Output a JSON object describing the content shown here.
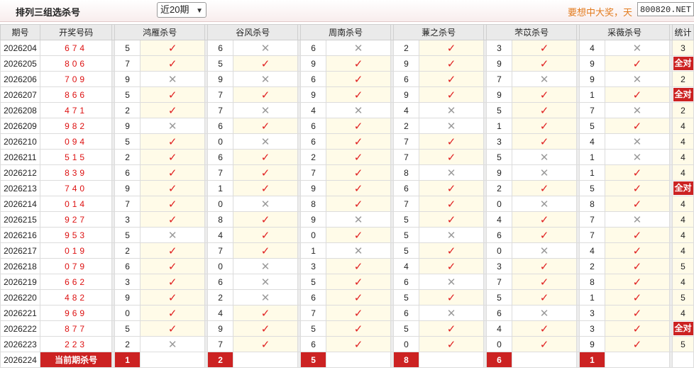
{
  "header": {
    "title": "排列三组选杀号",
    "period_select": "近20期",
    "slogan": "要想中大奖，天",
    "site": "800820.NET"
  },
  "columns": {
    "issue": "期号",
    "numbers": "开奖号码",
    "experts": [
      "鸿雁杀号",
      "谷风杀号",
      "周南杀号",
      "蒹之杀号",
      "芣苡杀号",
      "采薇杀号"
    ],
    "stats": "统计"
  },
  "icons": {
    "check": "check-icon",
    "cross": "cross-icon"
  },
  "colors": {
    "accent_red": "#cc2222",
    "check": "#e02020",
    "highlight": "#fffbe8",
    "slogan": "#e37b1e"
  },
  "rows": [
    {
      "issue": "2026204",
      "nums": "674",
      "kills": [
        {
          "n": "5",
          "ok": true
        },
        {
          "n": "6",
          "ok": false
        },
        {
          "n": "6",
          "ok": false
        },
        {
          "n": "2",
          "ok": true
        },
        {
          "n": "3",
          "ok": true
        },
        {
          "n": "4",
          "ok": false
        }
      ],
      "stat": "3"
    },
    {
      "issue": "2026205",
      "nums": "806",
      "kills": [
        {
          "n": "7",
          "ok": true
        },
        {
          "n": "5",
          "ok": true
        },
        {
          "n": "9",
          "ok": true
        },
        {
          "n": "9",
          "ok": true
        },
        {
          "n": "9",
          "ok": true
        },
        {
          "n": "9",
          "ok": true
        }
      ],
      "stat": "全对"
    },
    {
      "issue": "2026206",
      "nums": "709",
      "kills": [
        {
          "n": "9",
          "ok": false
        },
        {
          "n": "9",
          "ok": false
        },
        {
          "n": "6",
          "ok": true
        },
        {
          "n": "6",
          "ok": true
        },
        {
          "n": "7",
          "ok": false
        },
        {
          "n": "9",
          "ok": false
        }
      ],
      "stat": "2"
    },
    {
      "issue": "2026207",
      "nums": "866",
      "kills": [
        {
          "n": "5",
          "ok": true
        },
        {
          "n": "7",
          "ok": true
        },
        {
          "n": "9",
          "ok": true
        },
        {
          "n": "9",
          "ok": true
        },
        {
          "n": "9",
          "ok": true
        },
        {
          "n": "1",
          "ok": true
        }
      ],
      "stat": "全对"
    },
    {
      "issue": "2026208",
      "nums": "471",
      "kills": [
        {
          "n": "2",
          "ok": true
        },
        {
          "n": "7",
          "ok": false
        },
        {
          "n": "4",
          "ok": false
        },
        {
          "n": "4",
          "ok": false
        },
        {
          "n": "5",
          "ok": true
        },
        {
          "n": "7",
          "ok": false
        }
      ],
      "stat": "2"
    },
    {
      "issue": "2026209",
      "nums": "982",
      "kills": [
        {
          "n": "9",
          "ok": false
        },
        {
          "n": "6",
          "ok": true
        },
        {
          "n": "6",
          "ok": true
        },
        {
          "n": "2",
          "ok": false
        },
        {
          "n": "1",
          "ok": true
        },
        {
          "n": "5",
          "ok": true
        }
      ],
      "stat": "4"
    },
    {
      "issue": "2026210",
      "nums": "094",
      "kills": [
        {
          "n": "5",
          "ok": true
        },
        {
          "n": "0",
          "ok": false
        },
        {
          "n": "6",
          "ok": true
        },
        {
          "n": "7",
          "ok": true
        },
        {
          "n": "3",
          "ok": true
        },
        {
          "n": "4",
          "ok": false
        }
      ],
      "stat": "4"
    },
    {
      "issue": "2026211",
      "nums": "515",
      "kills": [
        {
          "n": "2",
          "ok": true
        },
        {
          "n": "6",
          "ok": true
        },
        {
          "n": "2",
          "ok": true
        },
        {
          "n": "7",
          "ok": true
        },
        {
          "n": "5",
          "ok": false
        },
        {
          "n": "1",
          "ok": false
        }
      ],
      "stat": "4"
    },
    {
      "issue": "2026212",
      "nums": "839",
      "kills": [
        {
          "n": "6",
          "ok": true
        },
        {
          "n": "7",
          "ok": true
        },
        {
          "n": "7",
          "ok": true
        },
        {
          "n": "8",
          "ok": false
        },
        {
          "n": "9",
          "ok": false
        },
        {
          "n": "1",
          "ok": true
        }
      ],
      "stat": "4"
    },
    {
      "issue": "2026213",
      "nums": "740",
      "kills": [
        {
          "n": "9",
          "ok": true
        },
        {
          "n": "1",
          "ok": true
        },
        {
          "n": "9",
          "ok": true
        },
        {
          "n": "6",
          "ok": true
        },
        {
          "n": "2",
          "ok": true
        },
        {
          "n": "5",
          "ok": true
        }
      ],
      "stat": "全对"
    },
    {
      "issue": "2026214",
      "nums": "014",
      "kills": [
        {
          "n": "7",
          "ok": true
        },
        {
          "n": "0",
          "ok": false
        },
        {
          "n": "8",
          "ok": true
        },
        {
          "n": "7",
          "ok": true
        },
        {
          "n": "0",
          "ok": false
        },
        {
          "n": "8",
          "ok": true
        }
      ],
      "stat": "4"
    },
    {
      "issue": "2026215",
      "nums": "927",
      "kills": [
        {
          "n": "3",
          "ok": true
        },
        {
          "n": "8",
          "ok": true
        },
        {
          "n": "9",
          "ok": false
        },
        {
          "n": "5",
          "ok": true
        },
        {
          "n": "4",
          "ok": true
        },
        {
          "n": "7",
          "ok": false
        }
      ],
      "stat": "4"
    },
    {
      "issue": "2026216",
      "nums": "953",
      "kills": [
        {
          "n": "5",
          "ok": false
        },
        {
          "n": "4",
          "ok": true
        },
        {
          "n": "0",
          "ok": true
        },
        {
          "n": "5",
          "ok": false
        },
        {
          "n": "6",
          "ok": true
        },
        {
          "n": "7",
          "ok": true
        }
      ],
      "stat": "4"
    },
    {
      "issue": "2026217",
      "nums": "019",
      "kills": [
        {
          "n": "2",
          "ok": true
        },
        {
          "n": "7",
          "ok": true
        },
        {
          "n": "1",
          "ok": false
        },
        {
          "n": "5",
          "ok": true
        },
        {
          "n": "0",
          "ok": false
        },
        {
          "n": "4",
          "ok": true
        }
      ],
      "stat": "4"
    },
    {
      "issue": "2026218",
      "nums": "079",
      "kills": [
        {
          "n": "6",
          "ok": true
        },
        {
          "n": "0",
          "ok": false
        },
        {
          "n": "3",
          "ok": true
        },
        {
          "n": "4",
          "ok": true
        },
        {
          "n": "3",
          "ok": true
        },
        {
          "n": "2",
          "ok": true
        }
      ],
      "stat": "5"
    },
    {
      "issue": "2026219",
      "nums": "662",
      "kills": [
        {
          "n": "3",
          "ok": true
        },
        {
          "n": "6",
          "ok": false
        },
        {
          "n": "5",
          "ok": true
        },
        {
          "n": "6",
          "ok": false
        },
        {
          "n": "7",
          "ok": true
        },
        {
          "n": "8",
          "ok": true
        }
      ],
      "stat": "4"
    },
    {
      "issue": "2026220",
      "nums": "482",
      "kills": [
        {
          "n": "9",
          "ok": true
        },
        {
          "n": "2",
          "ok": false
        },
        {
          "n": "6",
          "ok": true
        },
        {
          "n": "5",
          "ok": true
        },
        {
          "n": "5",
          "ok": true
        },
        {
          "n": "1",
          "ok": true
        }
      ],
      "stat": "5"
    },
    {
      "issue": "2026221",
      "nums": "969",
      "kills": [
        {
          "n": "0",
          "ok": true
        },
        {
          "n": "4",
          "ok": true
        },
        {
          "n": "7",
          "ok": true
        },
        {
          "n": "6",
          "ok": false
        },
        {
          "n": "6",
          "ok": false
        },
        {
          "n": "3",
          "ok": true
        }
      ],
      "stat": "4"
    },
    {
      "issue": "2026222",
      "nums": "877",
      "kills": [
        {
          "n": "5",
          "ok": true
        },
        {
          "n": "9",
          "ok": true
        },
        {
          "n": "5",
          "ok": true
        },
        {
          "n": "5",
          "ok": true
        },
        {
          "n": "4",
          "ok": true
        },
        {
          "n": "3",
          "ok": true
        }
      ],
      "stat": "全对"
    },
    {
      "issue": "2026223",
      "nums": "223",
      "kills": [
        {
          "n": "2",
          "ok": false
        },
        {
          "n": "7",
          "ok": true
        },
        {
          "n": "6",
          "ok": true
        },
        {
          "n": "0",
          "ok": true
        },
        {
          "n": "0",
          "ok": true
        },
        {
          "n": "9",
          "ok": true
        }
      ],
      "stat": "5"
    }
  ],
  "current": {
    "issue": "2026224",
    "label": "当前期杀号",
    "kills": [
      "1",
      "2",
      "5",
      "8",
      "6",
      "1"
    ]
  }
}
